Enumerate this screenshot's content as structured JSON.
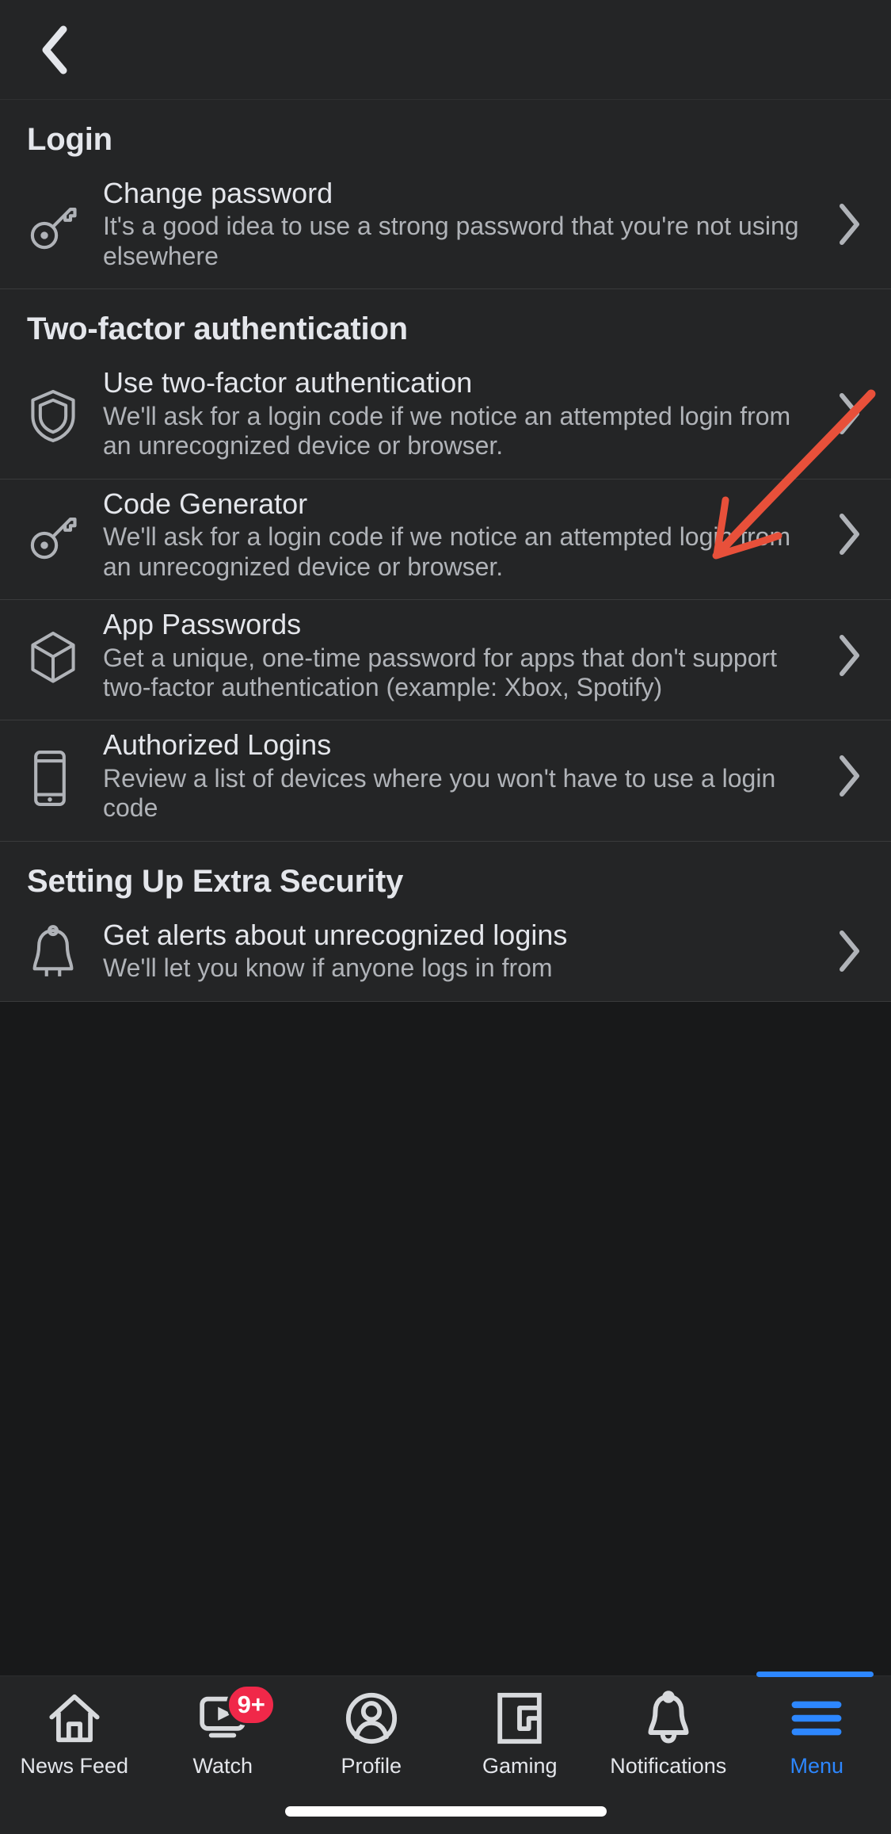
{
  "header": {
    "back_icon": "chevron-left-icon"
  },
  "sections": [
    {
      "id": "login",
      "title": "Login",
      "rows": [
        {
          "id": "change-password",
          "icon": "key-icon",
          "title": "Change password",
          "subtitle": "It's a good idea to use a strong password that you're not using elsewhere",
          "chevron": "chevron-right-icon"
        }
      ]
    },
    {
      "id": "two-factor-authentication",
      "title": "Two-factor authentication",
      "rows": [
        {
          "id": "use-two-factor-authentication",
          "icon": "shield-icon",
          "title": "Use two-factor authentication",
          "subtitle": "We'll ask for a login code if we notice an attempted login from an unrecognized device or browser.",
          "chevron": "chevron-right-icon"
        },
        {
          "id": "code-generator",
          "icon": "key-icon",
          "title": "Code Generator",
          "subtitle": "We'll ask for a login code if we notice an attempted login from an unrecognized device or browser.",
          "chevron": "chevron-right-icon"
        },
        {
          "id": "app-passwords",
          "icon": "cube-icon",
          "title": "App Passwords",
          "subtitle": "Get a unique, one-time password for apps that don't support two-factor authentication (example: Xbox, Spotify)",
          "chevron": "chevron-right-icon"
        },
        {
          "id": "authorized-logins",
          "icon": "mobile-phone-icon",
          "title": "Authorized Logins",
          "subtitle": "Review a list of devices where you won't have to use a login code",
          "chevron": "chevron-right-icon"
        }
      ]
    },
    {
      "id": "setting-up-extra-security",
      "title": "Setting Up Extra Security",
      "rows": [
        {
          "id": "get-alerts-about-unrecognized-logins",
          "icon": "bell-icon",
          "title": "Get alerts about unrecognized logins",
          "subtitle": "We'll let you know if anyone logs in from",
          "chevron": "chevron-right-icon"
        }
      ]
    }
  ],
  "annotation": {
    "type": "arrow",
    "color": "#e8503a",
    "points_to": "two-factor-authentication-heading"
  },
  "tabbar": {
    "items": [
      {
        "id": "news-feed",
        "label": "News Feed",
        "icon": "home-icon",
        "active": false,
        "badge": null
      },
      {
        "id": "watch",
        "label": "Watch",
        "icon": "video-play-icon",
        "active": false,
        "badge": "9+"
      },
      {
        "id": "profile",
        "label": "Profile",
        "icon": "person-circle-icon",
        "active": false,
        "badge": null
      },
      {
        "id": "gaming",
        "label": "Gaming",
        "icon": "gaming-icon",
        "active": false,
        "badge": null
      },
      {
        "id": "notifications",
        "label": "Notifications",
        "icon": "bell-icon",
        "active": false,
        "badge": null
      },
      {
        "id": "menu",
        "label": "Menu",
        "icon": "hamburger-icon",
        "active": true,
        "badge": null
      }
    ]
  },
  "colors": {
    "background": "#18191a",
    "surface": "#242526",
    "primary_text": "#e4e6eb",
    "secondary_text": "#b0b3b8",
    "accent": "#2d87ff",
    "badge": "#f02849",
    "annotation": "#e8503a"
  }
}
